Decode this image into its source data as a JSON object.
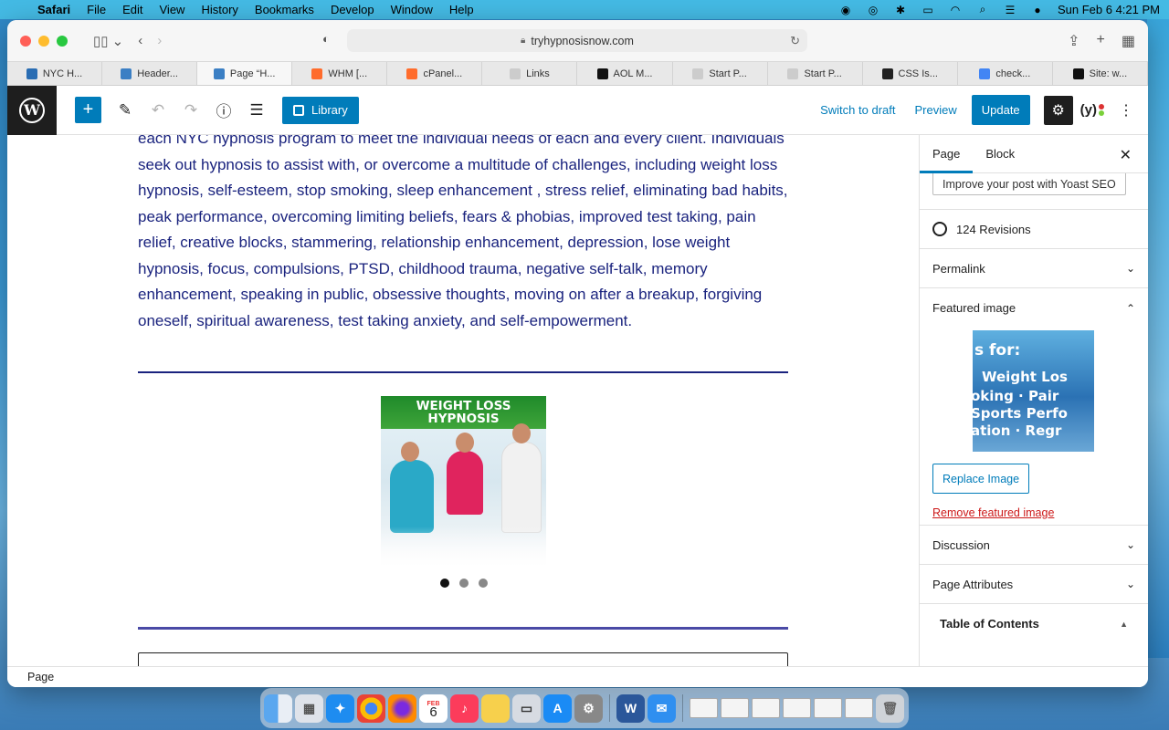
{
  "menubar": {
    "app": "Safari",
    "items": [
      "File",
      "Edit",
      "View",
      "History",
      "Bookmarks",
      "Develop",
      "Window",
      "Help"
    ],
    "clock": "Sun Feb 6  4:21 PM"
  },
  "browser": {
    "url": "tryhypnosisnow.com",
    "tabs": [
      {
        "label": "NYC H...",
        "color": "#2a6db3"
      },
      {
        "label": "Header...",
        "color": "#3b7fc4"
      },
      {
        "label": "Page “H...",
        "color": "#3b7fc4"
      },
      {
        "label": "WHM [...",
        "color": "#ff6c2c"
      },
      {
        "label": "cPanel...",
        "color": "#ff6c2c"
      },
      {
        "label": "Links",
        "color": "#cccccc"
      },
      {
        "label": "AOL M...",
        "color": "#111111"
      },
      {
        "label": "Start P...",
        "color": "#cccccc"
      },
      {
        "label": "Start P...",
        "color": "#cccccc"
      },
      {
        "label": "CSS Is...",
        "color": "#222222"
      },
      {
        "label": "check...",
        "color": "#4285f4"
      },
      {
        "label": "Site: w...",
        "color": "#111111"
      }
    ]
  },
  "editor": {
    "library_label": "Library",
    "switch_to_draft": "Switch to draft",
    "preview": "Preview",
    "update": "Update"
  },
  "content": {
    "paragraph": "each NYC hypnosis program to meet the individual needs of each and every client. Individuals seek out hypnosis to assist with, or overcome a multitude of challenges, including weight loss hypnosis, self-esteem, stop smoking, sleep enhancement , stress relief, eliminating bad habits, peak performance, overcoming limiting beliefs, fears & phobias, improved test taking, pain relief, creative blocks, stammering, relationship enhancement, depression, lose weight hypnosis, focus, compulsions, PTSD, childhood trauma, negative self-talk, memory enhancement, speaking in public, obsessive thoughts, moving on after a breakup, forgiving oneself, spiritual awareness, test taking anxiety, and self-empowerment.",
    "slide_banner_1": "WEIGHT LOSS",
    "slide_banner_2": "HYPNOSIS"
  },
  "sidebar": {
    "tab_page": "Page",
    "tab_block": "Block",
    "yoast_improve": "Improve your post with Yoast SEO",
    "revisions": "124 Revisions",
    "permalink": "Permalink",
    "featured_image": "Featured image",
    "featured_lines": [
      "s for:",
      "Weight Los",
      "oking · Pair",
      "Sports Perfo",
      "ation · Regr"
    ],
    "replace_image": "Replace Image",
    "remove_featured": "Remove featured image",
    "discussion": "Discussion",
    "page_attributes": "Page Attributes",
    "table_of_contents": "Table of Contents"
  },
  "statusbar": {
    "label": "Page"
  },
  "dock": {
    "calendar_month": "FEB",
    "calendar_day": "6"
  }
}
